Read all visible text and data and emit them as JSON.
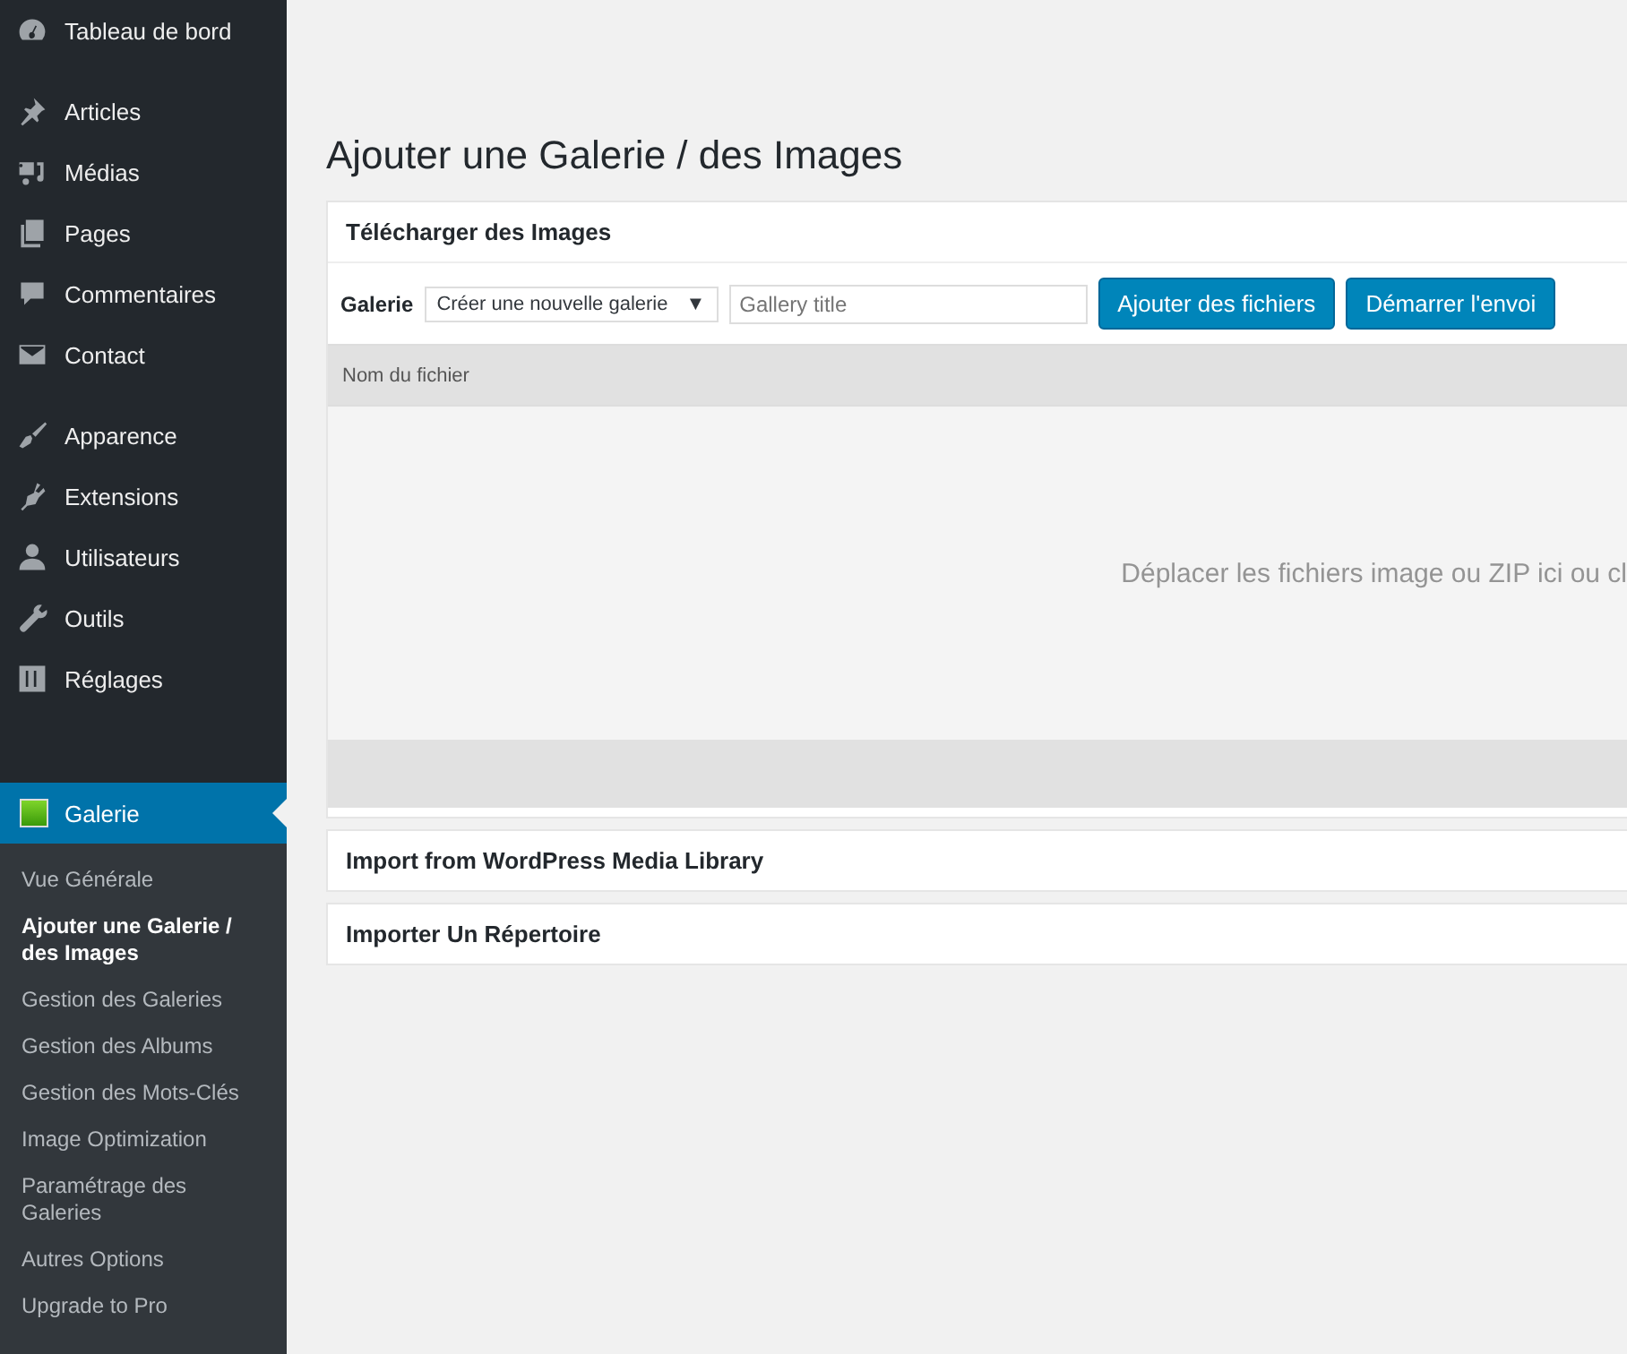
{
  "sidebar": {
    "menu_groups": [
      {
        "items": [
          {
            "label": "Tableau de bord"
          }
        ]
      },
      {
        "items": [
          {
            "label": "Articles"
          },
          {
            "label": "Médias"
          },
          {
            "label": "Pages"
          },
          {
            "label": "Commentaires"
          },
          {
            "label": "Contact"
          }
        ]
      },
      {
        "items": [
          {
            "label": "Apparence"
          },
          {
            "label": "Extensions"
          },
          {
            "label": "Utilisateurs"
          },
          {
            "label": "Outils"
          },
          {
            "label": "Réglages"
          }
        ]
      }
    ],
    "current": {
      "label": "Galerie",
      "submenu": [
        {
          "label": "Vue Générale",
          "selected": false
        },
        {
          "label": "Ajouter une Galerie / des Images",
          "selected": true
        },
        {
          "label": "Gestion des Galeries",
          "selected": false
        },
        {
          "label": "Gestion des Albums",
          "selected": false
        },
        {
          "label": "Gestion des Mots-Clés",
          "selected": false
        },
        {
          "label": "Image Optimization",
          "selected": false
        },
        {
          "label": "Paramétrage des Galeries",
          "selected": false
        },
        {
          "label": "Autres Options",
          "selected": false
        },
        {
          "label": "Upgrade to Pro",
          "selected": false
        }
      ]
    }
  },
  "page_title": "Ajouter une Galerie / des Images",
  "upload_panel": {
    "title": "Télécharger des Images",
    "gallery_label": "Galerie",
    "gallery_select": "Créer une nouvelle galerie",
    "select_caret": "▼",
    "title_field": {
      "placeholder": "Gallery title"
    },
    "buttons": [
      "Ajouter des fichiers",
      "Démarrer l'envoi"
    ],
    "column": "Nom du fichier",
    "drop_hint": "Déplacer les fichiers image ou ZIP ici ou cl"
  },
  "other_panels": [
    {
      "title": "Import from WordPress Media Library"
    },
    {
      "title": "Importer Un Répertoire"
    }
  ]
}
